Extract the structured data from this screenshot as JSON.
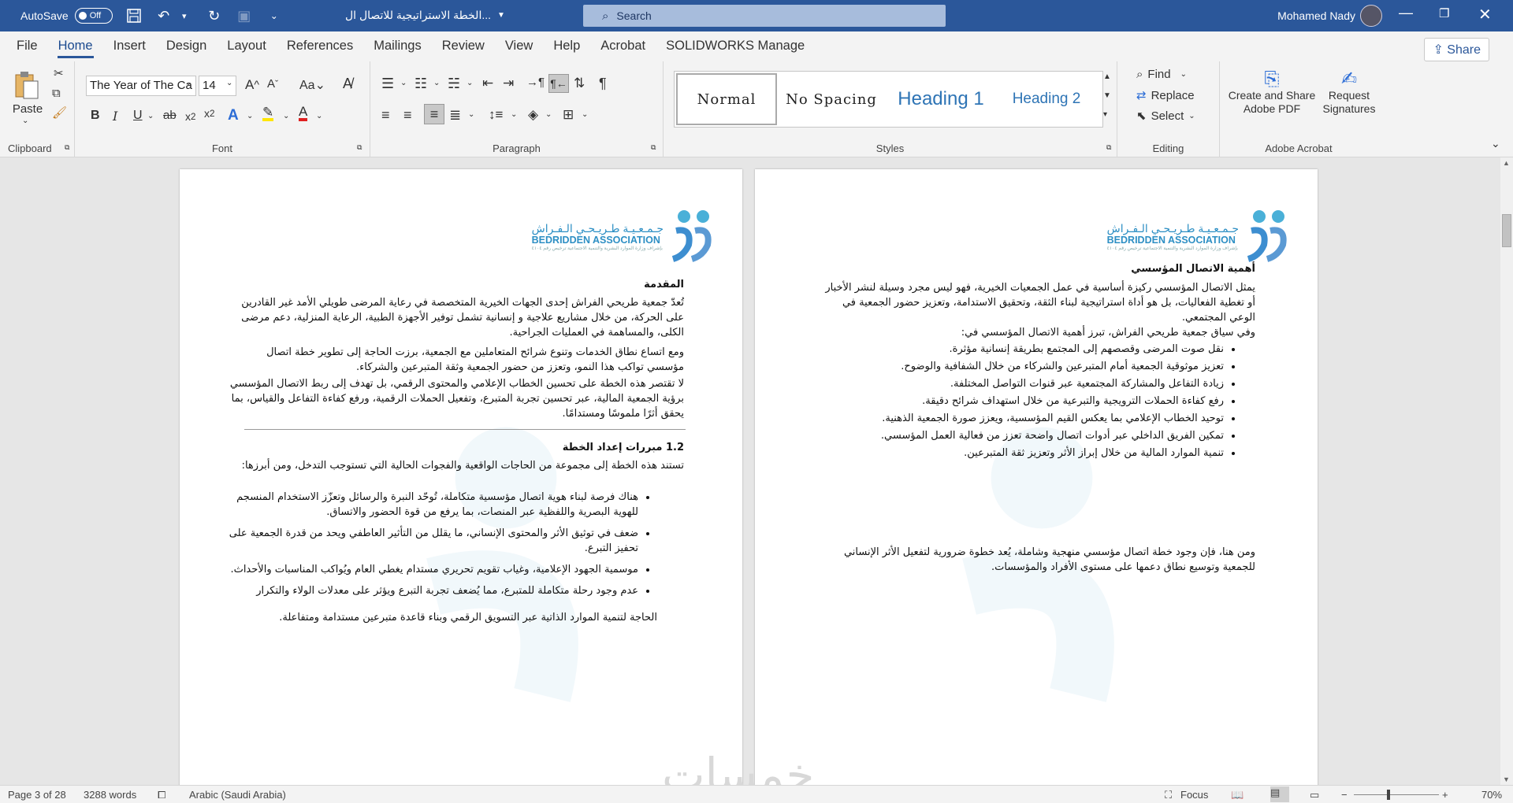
{
  "titlebar": {
    "autosave_label": "AutoSave",
    "autosave_state": "Off",
    "doc_title": "الخطة الاستراتيجية للاتصال ال...",
    "search_placeholder": "Search",
    "user_name": "Mohamed Nady",
    "accent": "#2b579a"
  },
  "tabs": [
    "File",
    "Home",
    "Insert",
    "Design",
    "Layout",
    "References",
    "Mailings",
    "Review",
    "View",
    "Help",
    "Acrobat",
    "SOLIDWORKS Manage"
  ],
  "share_label": "Share",
  "ribbon": {
    "clipboard": {
      "paste": "Paste",
      "label": "Clipboard"
    },
    "font": {
      "name": "The Year of The Ca",
      "size": "14",
      "label": "Font"
    },
    "paragraph": {
      "label": "Paragraph"
    },
    "styles": {
      "normal": "Normal",
      "no_spacing": "No Spacing",
      "heading1": "Heading 1",
      "heading2": "Heading 2",
      "label": "Styles"
    },
    "editing": {
      "find": "Find",
      "replace": "Replace",
      "select": "Select",
      "label": "Editing"
    },
    "acrobat": {
      "create": "Create and Share",
      "create2": "Adobe PDF",
      "request": "Request",
      "request2": "Signatures",
      "label": "Adobe Acrobat"
    }
  },
  "logo": {
    "ar": "جـمـعـيـة طـريـحـي الـفـراش",
    "en": "BEDRIDDEN ASSOCIATION",
    "tiny": "بإشراف وزارة الموارد البشرية والتنمية الاجتماعية ترخيص رقم ٤١٠٤"
  },
  "page_left": {
    "heading_intro": "المقدمة",
    "p1": "تُعدّ جمعية طريحي الفراش إحدى الجهات الخيرية المتخصصة في رعاية المرضى طويلي الأمد غير القادرين على الحركة، من خلال مشاريع علاجية و إنسانية تشمل توفير الأجهزة الطبية، الرعاية المنزلية، دعم مرضى الكلى، والمساهمة في العمليات الجراحية.",
    "p2": "ومع اتساع نطاق الخدمات وتنوع شرائح المتعاملين مع الجمعية، برزت الحاجة إلى تطوير خطة اتصال مؤسسي تواكب هذا النمو، وتعزز من حضور الجمعية وثقة المتبرعين والشركاء.",
    "p3": " لا تقتصر هذه الخطة على تحسين الخطاب الإعلامي والمحتوى الرقمي، بل تهدف إلى ربط الاتصال المؤسسي برؤية الجمعية المالية، عبر تحسين تجربة المتبرع، وتفعيل الحملات الرقمية، ورفع كفاءة التفاعل والقياس، بما يحقق أثرًا ملموسًا ومستدامًا.",
    "heading_reasons": "1.2 مبررات إعداد الخطة",
    "p4": "تستند هذه الخطة إلى مجموعة من الحاجات الواقعية والفجوات الحالية التي تستوجب التدخل، ومن أبرزها:",
    "bullets": [
      "هناك فرصة لبناء هوية اتصال مؤسسية متكاملة، تُوحّد النبرة والرسائل وتعزّز الاستخدام المنسجم للهوية البصرية واللفظية عبر المنصات، بما يرفع من قوة الحضور والاتساق.",
      "ضعف في توثيق الأثر والمحتوى الإنساني، ما يقلل من التأثير العاطفي ويحد من قدرة الجمعية على تحفيز التبرع.",
      "موسمية الجهود الإعلامية، وغياب تقويم تحريري مستدام يغطي العام ويُواكب المناسبات والأحداث.",
      "عدم وجود رحلة متكاملة للمتبرع، مما يُضعف تجربة التبرع ويؤثر على معدلات الولاء والتكرار"
    ],
    "p5": "الحاجة لتنمية الموارد الذاتية عبر التسويق الرقمي وبناء قاعدة متبرعين مستدامة ومتفاعلة."
  },
  "page_right": {
    "heading": "أهمية الاتصال المؤسسي",
    "p1": "يمثل الاتصال المؤسسي ركيزة أساسية في عمل الجمعيات الخيرية، فهو ليس مجرد وسيلة لنشر الأخبار أو تغطية الفعاليات، بل هو أداة استراتيجية لبناء الثقة، وتحقيق الاستدامة، وتعزيز حضور الجمعية في الوعي المجتمعي.",
    "p2": "وفي سياق جمعية طريحي الفراش، تبرز أهمية الاتصال المؤسسي في:",
    "bullets": [
      "نقل صوت المرضى وقصصهم إلى المجتمع بطريقة إنسانية مؤثرة.",
      "تعزيز موثوقية الجمعية أمام المتبرعين والشركاء من خلال الشفافية والوضوح.",
      "زيادة التفاعل والمشاركة المجتمعية عبر قنوات التواصل المختلفة.",
      "رفع كفاءة الحملات الترويجية والتبرعية من خلال استهداف شرائح دقيقة.",
      "توحيد الخطاب الإعلامي بما يعكس القيم المؤسسية، ويعزز صورة الجمعية الذهنية.",
      "تمكين الفريق الداخلي عبر أدوات اتصال واضحة تعزز من فعالية العمل المؤسسي.",
      "تنمية الموارد المالية من خلال إبراز الأثر وتعزيز ثقة المتبرعين."
    ],
    "p3": "ومن هنا، فإن وجود خطة اتصال مؤسسي منهجية وشاملة، يُعد خطوة ضرورية لتفعيل الأثر الإنساني للجمعية وتوسيع نطاق دعمها على مستوى الأفراد والمؤسسات."
  },
  "status": {
    "page": "Page 3 of 28",
    "words": "3288 words",
    "language": "Arabic (Saudi Arabia)",
    "focus": "Focus",
    "zoom": "70%"
  },
  "brand_watermark": "خمسات"
}
